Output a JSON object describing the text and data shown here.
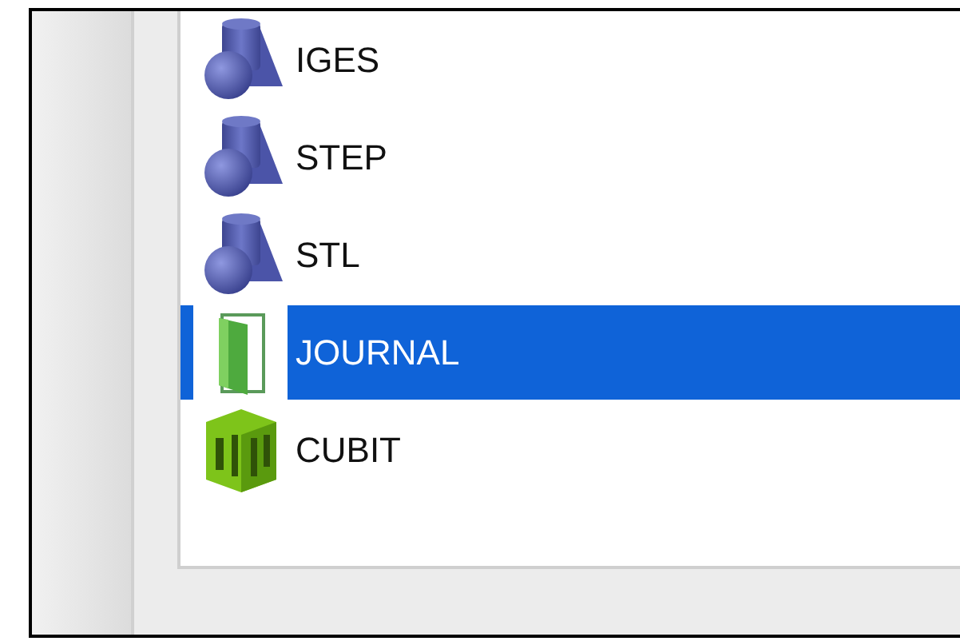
{
  "file_types": [
    {
      "label": "IGES",
      "kind": "geometry",
      "selected": false
    },
    {
      "label": "STEP",
      "kind": "geometry",
      "selected": false
    },
    {
      "label": "STL",
      "kind": "geometry",
      "selected": false
    },
    {
      "label": "JOURNAL",
      "kind": "journal",
      "selected": true
    },
    {
      "label": "CUBIT",
      "kind": "cubit",
      "selected": false
    }
  ]
}
